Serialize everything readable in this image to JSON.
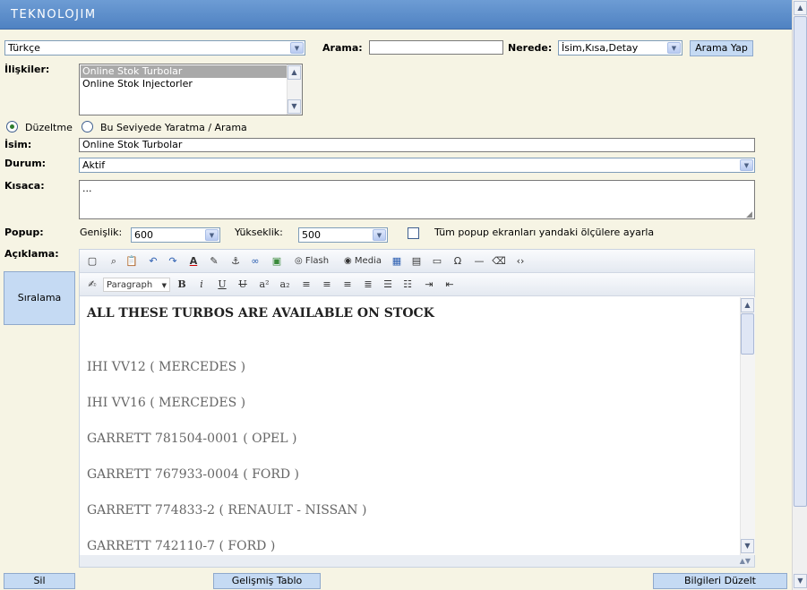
{
  "app": {
    "logo": "TEKNOLOJIM"
  },
  "language": {
    "selected": "Türkçe"
  },
  "search": {
    "label": "Arama:",
    "value": "",
    "where_label": "Nerede:",
    "where_selected": "İsim,Kısa,Detay",
    "button_label": "Arama Yap"
  },
  "relations": {
    "label": "İlişkiler:",
    "items": [
      "Online Stok Turbolar",
      "Online Stok Injectorler"
    ]
  },
  "mode": {
    "edit_label": "Düzeltme",
    "create_label": "Bu Seviyede Yaratma / Arama",
    "selected": "edit"
  },
  "name": {
    "label": "İsim:",
    "value": "Online Stok Turbolar"
  },
  "status": {
    "label": "Durum:",
    "selected": "Aktif"
  },
  "summary": {
    "label": "Kısaca:",
    "value": "..."
  },
  "popup": {
    "label": "Popup:",
    "width_label": "Genişlik:",
    "width_value": "600",
    "height_label": "Yükseklik:",
    "height_value": "500",
    "apply_all_label": "Tüm popup ekranları yandaki ölçülere ayarla",
    "apply_all_checked": false
  },
  "description": {
    "label": "Açıklama:"
  },
  "sort_button": {
    "label": "Sıralama"
  },
  "editor": {
    "toolbar1": {
      "flash_label": "Flash",
      "media_label": "Media"
    },
    "toolbar2": {
      "format_selected": "Paragraph"
    },
    "heading": "ALL THESE TURBOS ARE AVAILABLE ON STOCK",
    "lines": [
      "IHI VV12    ( MERCEDES )",
      "IHI VV16    ( MERCEDES )",
      "GARRETT 781504-0001  ( OPEL )",
      "GARRETT 767933-0004  ( FORD )",
      "GARRETT 774833-2 ( RENAULT - NISSAN )",
      "GARRETT  742110-7   ( FORD )"
    ]
  },
  "footer": {
    "delete_label": "Sil",
    "advanced_table_label": "Gelişmiş Tablo",
    "update_label": "Bilgileri Düzelt"
  }
}
